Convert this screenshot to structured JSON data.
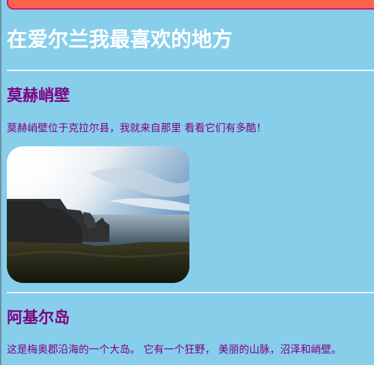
{
  "page": {
    "title": "在爱尔兰我最喜欢的地方"
  },
  "sections": [
    {
      "heading": "莫赫峭壁",
      "text": "莫赫峭壁位于克拉尔县，我就来自那里 看看它们有多酷！"
    },
    {
      "heading": "阿基尔岛",
      "text": "这是梅奥郡沿海的一个大岛。 它有一个狂野， 美丽的山脉，沼泽和峭壁。"
    }
  ],
  "colors": {
    "background": "#87ceeb",
    "banner": "#ff6347",
    "banner_border": "#c71585",
    "title": "#ffffff",
    "heading": "#800080",
    "text": "#800080"
  }
}
